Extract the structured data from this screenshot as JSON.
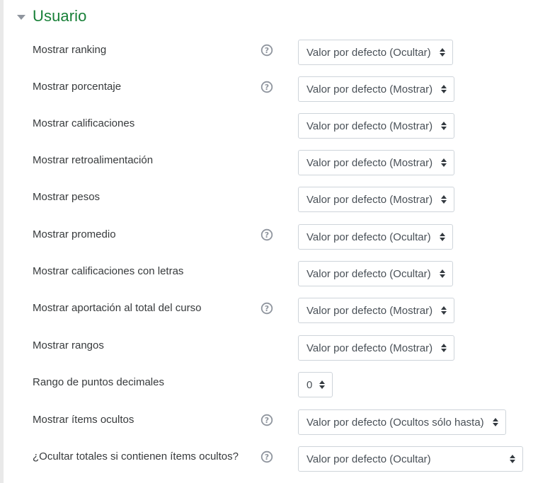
{
  "section": {
    "title": "Usuario",
    "collapse_icon": "caret-down-icon"
  },
  "help_icon": "question-circle-icon",
  "colors": {
    "title": "#188038",
    "help_icon": "#8f959e",
    "select_border": "#ced4da",
    "label_text": "#373a3c"
  },
  "rows": [
    {
      "label": "Mostrar ranking",
      "has_help": true,
      "value": "Valor por defecto (Ocultar)"
    },
    {
      "label": "Mostrar porcentaje",
      "has_help": true,
      "value": "Valor por defecto (Mostrar)"
    },
    {
      "label": "Mostrar calificaciones",
      "has_help": false,
      "value": "Valor por defecto (Mostrar)"
    },
    {
      "label": "Mostrar retroalimentación",
      "has_help": false,
      "value": "Valor por defecto (Mostrar)"
    },
    {
      "label": "Mostrar pesos",
      "has_help": false,
      "value": "Valor por defecto (Mostrar)"
    },
    {
      "label": "Mostrar promedio",
      "has_help": true,
      "value": "Valor por defecto (Ocultar)"
    },
    {
      "label": "Mostrar calificaciones con letras",
      "has_help": false,
      "value": "Valor por defecto (Ocultar)"
    },
    {
      "label": "Mostrar aportación al total del curso",
      "has_help": true,
      "value": "Valor por defecto (Mostrar)"
    },
    {
      "label": "Mostrar rangos",
      "has_help": false,
      "value": "Valor por defecto (Mostrar)"
    },
    {
      "label": "Rango de puntos decimales",
      "has_help": false,
      "value": "0"
    },
    {
      "label": "Mostrar ítems ocultos",
      "has_help": true,
      "value": "Valor por defecto (Ocultos sólo hasta)"
    },
    {
      "label": "¿Ocultar totales si contienen ítems ocultos?",
      "has_help": true,
      "value": "Valor por defecto (Ocultar)"
    }
  ]
}
